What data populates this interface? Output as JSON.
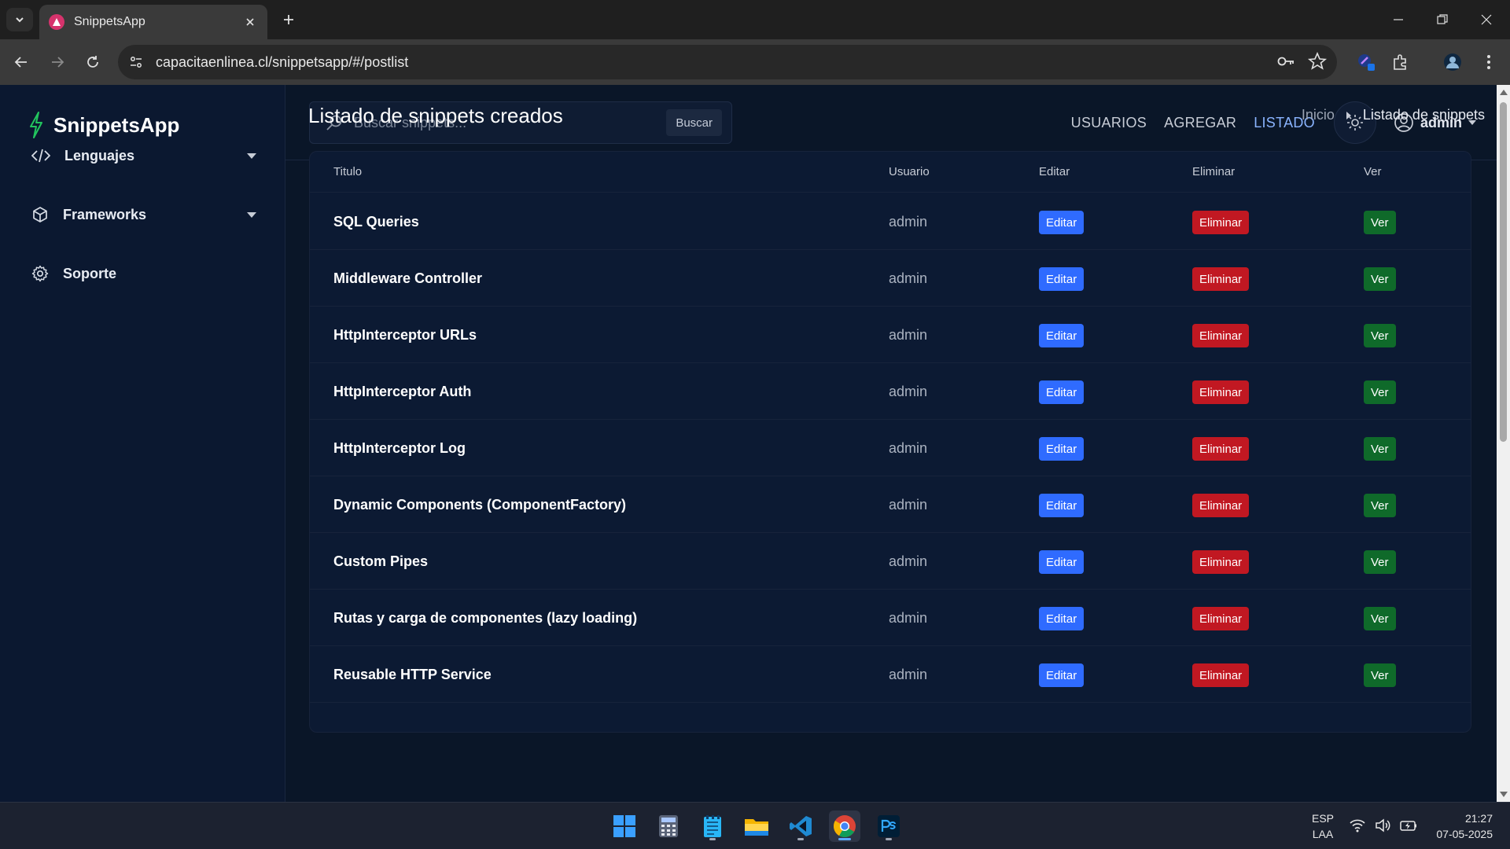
{
  "browser": {
    "tab_title": "SnippetsApp",
    "url": "capacitaenlinea.cl/snippetsapp/#/postlist"
  },
  "brand": {
    "name": "SnippetsApp"
  },
  "sidebar": {
    "items": [
      {
        "label": "Lenguajes",
        "icon": "code-icon"
      },
      {
        "label": "Frameworks",
        "icon": "cube-icon"
      },
      {
        "label": "Soporte",
        "icon": "gear-icon"
      }
    ]
  },
  "search": {
    "placeholder": "Buscar snippets...",
    "button": "Buscar"
  },
  "topnav": {
    "links": [
      "USUARIOS",
      "AGREGAR",
      "LISTADO"
    ],
    "active": "LISTADO",
    "user": "admin"
  },
  "page": {
    "title": "Listado de snippets creados",
    "breadcrumb": {
      "home": "Inicio",
      "current": "Listado de snippets"
    }
  },
  "table": {
    "headers": [
      "Titulo",
      "Usuario",
      "Editar",
      "Eliminar",
      "Ver"
    ],
    "rows": [
      {
        "title": "SQL Queries",
        "user": "admin",
        "edit": "Editar",
        "delete": "Eliminar",
        "view": "Ver"
      },
      {
        "title": "Middleware Controller",
        "user": "admin",
        "edit": "Editar",
        "delete": "Eliminar",
        "view": "Ver"
      },
      {
        "title": "HttpInterceptor URLs",
        "user": "admin",
        "edit": "Editar",
        "delete": "Eliminar",
        "view": "Ver"
      },
      {
        "title": "HttpInterceptor Auth",
        "user": "admin",
        "edit": "Editar",
        "delete": "Eliminar",
        "view": "Ver"
      },
      {
        "title": "HttpInterceptor Log",
        "user": "admin",
        "edit": "Editar",
        "delete": "Eliminar",
        "view": "Ver"
      },
      {
        "title": "Dynamic Components (ComponentFactory)",
        "user": "admin",
        "edit": "Editar",
        "delete": "Eliminar",
        "view": "Ver"
      },
      {
        "title": "Custom Pipes",
        "user": "admin",
        "edit": "Editar",
        "delete": "Eliminar",
        "view": "Ver"
      },
      {
        "title": "Rutas y carga de componentes (lazy loading)",
        "user": "admin",
        "edit": "Editar",
        "delete": "Eliminar",
        "view": "Ver"
      },
      {
        "title": "Reusable HTTP Service",
        "user": "admin",
        "edit": "Editar",
        "delete": "Eliminar",
        "view": "Ver"
      }
    ]
  },
  "colors": {
    "accent": "#8ab4ff",
    "edit": "#2f6bff",
    "delete": "#c11822",
    "view": "#0f6a2a",
    "brand_bolt": "#22c55e"
  },
  "taskbar": {
    "apps": [
      "windows-start-icon",
      "calculator-icon",
      "notepad-icon",
      "file-explorer-icon",
      "vscode-icon",
      "chrome-icon",
      "photoshop-icon"
    ],
    "lang_top": "ESP",
    "lang_bottom": "LAA",
    "time": "21:27",
    "date": "07-05-2025"
  }
}
